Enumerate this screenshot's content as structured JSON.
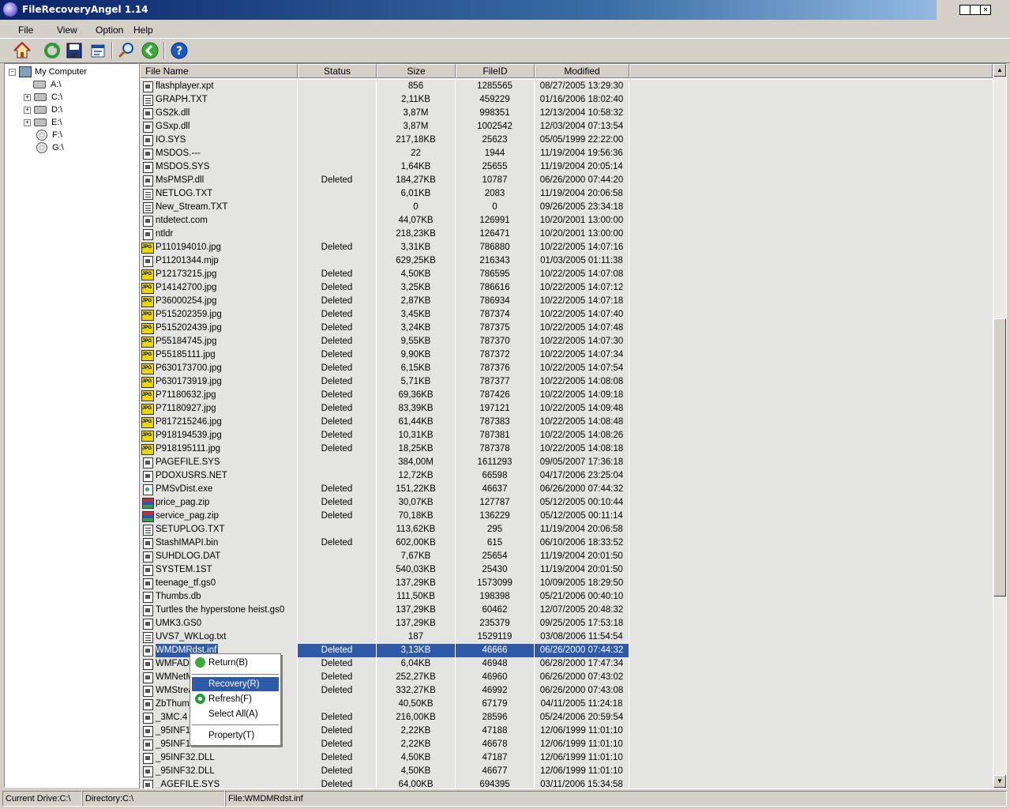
{
  "window": {
    "title": "FileRecoveryAngel 1.14",
    "controls": [
      "minimize",
      "maximize",
      "close"
    ]
  },
  "menu": {
    "file": "File",
    "view": "View",
    "option": "Option",
    "help": "Help"
  },
  "toolbar": {
    "buttons": [
      "home-icon",
      "refresh-icon",
      "save-icon",
      "properties-icon",
      "search-icon",
      "back-icon",
      "help-icon"
    ]
  },
  "tree": {
    "root": "My Computer",
    "drives": [
      "A:\\",
      "C:\\",
      "D:\\",
      "E:\\",
      "F:\\",
      "G:\\"
    ],
    "expanders": [
      "−",
      "+",
      "+",
      "+"
    ]
  },
  "list": {
    "columns": [
      "File Name",
      "Status",
      "Size",
      "FileID",
      "Modified"
    ],
    "rows": [
      {
        "name": "flashplayer.xpt",
        "status": "",
        "size": "856",
        "id": "1285565",
        "modified": "08/27/2005 13:29:30",
        "icon": "sys"
      },
      {
        "name": "GRAPH.TXT",
        "status": "",
        "size": "2,11KB",
        "id": "459229",
        "modified": "01/16/2006 18:02:40",
        "icon": "txt"
      },
      {
        "name": "GS2k.dll",
        "status": "",
        "size": "3,87M",
        "id": "998351",
        "modified": "12/13/2004 10:58:32",
        "icon": "sys"
      },
      {
        "name": "GSxp.dll",
        "status": "",
        "size": "3,87M",
        "id": "1002542",
        "modified": "12/03/2004 07:13:54",
        "icon": "sys"
      },
      {
        "name": "IO.SYS",
        "status": "",
        "size": "217,18KB",
        "id": "25623",
        "modified": "05/05/1999 22:22:00",
        "icon": "sys"
      },
      {
        "name": "MSDOS.---",
        "status": "",
        "size": "22",
        "id": "1944",
        "modified": "11/19/2004 19:56:36",
        "icon": "sys"
      },
      {
        "name": "MSDOS.SYS",
        "status": "",
        "size": "1,64KB",
        "id": "25655",
        "modified": "11/19/2004 20:05:14",
        "icon": "sys"
      },
      {
        "name": "MsPMSP.dll",
        "status": "Deleted",
        "size": "184,27KB",
        "id": "10787",
        "modified": "06/26/2000 07:44:20",
        "icon": "sys"
      },
      {
        "name": "NETLOG.TXT",
        "status": "",
        "size": "6,01KB",
        "id": "2083",
        "modified": "11/19/2004 20:06:58",
        "icon": "txt"
      },
      {
        "name": "New_Stream.TXT",
        "status": "",
        "size": "0",
        "id": "0",
        "modified": "09/26/2005 23:34:18",
        "icon": "txt"
      },
      {
        "name": "ntdetect.com",
        "status": "",
        "size": "44,07KB",
        "id": "126991",
        "modified": "10/20/2001 13:00:00",
        "icon": "sys"
      },
      {
        "name": "ntldr",
        "status": "",
        "size": "218,23KB",
        "id": "126471",
        "modified": "10/20/2001 13:00:00",
        "icon": "sys"
      },
      {
        "name": "P110194010.jpg",
        "status": "Deleted",
        "size": "3,31KB",
        "id": "786880",
        "modified": "10/22/2005 14:07:16",
        "icon": "jpg"
      },
      {
        "name": "P11201344.mjp",
        "status": "",
        "size": "629,25KB",
        "id": "216343",
        "modified": "01/03/2005 01:11:38",
        "icon": "sys"
      },
      {
        "name": "P12173215.jpg",
        "status": "Deleted",
        "size": "4,50KB",
        "id": "786595",
        "modified": "10/22/2005 14:07:08",
        "icon": "jpg"
      },
      {
        "name": "P14142700.jpg",
        "status": "Deleted",
        "size": "3,25KB",
        "id": "786616",
        "modified": "10/22/2005 14:07:12",
        "icon": "jpg"
      },
      {
        "name": "P36000254.jpg",
        "status": "Deleted",
        "size": "2,87KB",
        "id": "786934",
        "modified": "10/22/2005 14:07:18",
        "icon": "jpg"
      },
      {
        "name": "P515202359.jpg",
        "status": "Deleted",
        "size": "3,45KB",
        "id": "787374",
        "modified": "10/22/2005 14:07:40",
        "icon": "jpg"
      },
      {
        "name": "P515202439.jpg",
        "status": "Deleted",
        "size": "3,24KB",
        "id": "787375",
        "modified": "10/22/2005 14:07:48",
        "icon": "jpg"
      },
      {
        "name": "P55184745.jpg",
        "status": "Deleted",
        "size": "9,55KB",
        "id": "787370",
        "modified": "10/22/2005 14:07:30",
        "icon": "jpg"
      },
      {
        "name": "P55185111.jpg",
        "status": "Deleted",
        "size": "9,90KB",
        "id": "787372",
        "modified": "10/22/2005 14:07:34",
        "icon": "jpg"
      },
      {
        "name": "P630173700.jpg",
        "status": "Deleted",
        "size": "6,15KB",
        "id": "787376",
        "modified": "10/22/2005 14:07:54",
        "icon": "jpg"
      },
      {
        "name": "P630173919.jpg",
        "status": "Deleted",
        "size": "5,71KB",
        "id": "787377",
        "modified": "10/22/2005 14:08:08",
        "icon": "jpg"
      },
      {
        "name": "P71180632.jpg",
        "status": "Deleted",
        "size": "69,36KB",
        "id": "787426",
        "modified": "10/22/2005 14:09:18",
        "icon": "jpg"
      },
      {
        "name": "P71180927.jpg",
        "status": "Deleted",
        "size": "83,39KB",
        "id": "197121",
        "modified": "10/22/2005 14:09:48",
        "icon": "jpg"
      },
      {
        "name": "P817215246.jpg",
        "status": "Deleted",
        "size": "61,44KB",
        "id": "787383",
        "modified": "10/22/2005 14:08:48",
        "icon": "jpg"
      },
      {
        "name": "P918194539.jpg",
        "status": "Deleted",
        "size": "10,31KB",
        "id": "787381",
        "modified": "10/22/2005 14:08:26",
        "icon": "jpg"
      },
      {
        "name": "P918195111.jpg",
        "status": "Deleted",
        "size": "18,25KB",
        "id": "787378",
        "modified": "10/22/2005 14:08:18",
        "icon": "jpg"
      },
      {
        "name": "PAGEFILE.SYS",
        "status": "",
        "size": "384,00M",
        "id": "1611293",
        "modified": "09/05/2007 17:36:18",
        "icon": "sys"
      },
      {
        "name": "PDOXUSRS.NET",
        "status": "",
        "size": "12,72KB",
        "id": "66598",
        "modified": "04/17/2006 23:25:04",
        "icon": "sys"
      },
      {
        "name": "PMSvDist.exe",
        "status": "Deleted",
        "size": "151,22KB",
        "id": "46637",
        "modified": "06/26/2000 07:44:32",
        "icon": "exe"
      },
      {
        "name": "price_pag.zip",
        "status": "Deleted",
        "size": "30,07KB",
        "id": "127787",
        "modified": "05/12/2005 00:10:44",
        "icon": "zip"
      },
      {
        "name": "service_pag.zip",
        "status": "Deleted",
        "size": "70,18KB",
        "id": "136229",
        "modified": "05/12/2005 00:11:14",
        "icon": "zip"
      },
      {
        "name": "SETUPLOG.TXT",
        "status": "",
        "size": "113,62KB",
        "id": "295",
        "modified": "11/19/2004 20:06:58",
        "icon": "txt"
      },
      {
        "name": "StashIMAPI.bin",
        "status": "Deleted",
        "size": "602,00KB",
        "id": "615",
        "modified": "06/10/2006 18:33:52",
        "icon": "sys"
      },
      {
        "name": "SUHDLOG.DAT",
        "status": "",
        "size": "7,67KB",
        "id": "25654",
        "modified": "11/19/2004 20:01:50",
        "icon": "sys"
      },
      {
        "name": "SYSTEM.1ST",
        "status": "",
        "size": "540,03KB",
        "id": "25430",
        "modified": "11/19/2004 20:01:50",
        "icon": "sys"
      },
      {
        "name": "teenage_tf.gs0",
        "status": "",
        "size": "137,29KB",
        "id": "1573099",
        "modified": "10/09/2005 18:29:50",
        "icon": "sys"
      },
      {
        "name": "Thumbs.db",
        "status": "",
        "size": "111,50KB",
        "id": "198398",
        "modified": "05/21/2006 00:40:10",
        "icon": "sys"
      },
      {
        "name": "Turtles the hyperstone heist.gs0",
        "status": "",
        "size": "137,29KB",
        "id": "60462",
        "modified": "12/07/2005 20:48:32",
        "icon": "sys"
      },
      {
        "name": "UMK3.GS0",
        "status": "",
        "size": "137,29KB",
        "id": "235379",
        "modified": "09/25/2005 17:53:18",
        "icon": "sys"
      },
      {
        "name": "UVS7_WKLog.txt",
        "status": "",
        "size": "187",
        "id": "1529119",
        "modified": "03/08/2006 11:54:54",
        "icon": "txt"
      },
      {
        "name": "WMDMRdst.inf",
        "status": "Deleted",
        "size": "3,13KB",
        "id": "46666",
        "modified": "06/26/2000 07:44:32",
        "icon": "sys",
        "selected": true
      },
      {
        "name": "WMFADist.exe",
        "status": "Deleted",
        "size": "6,04KB",
        "id": "46948",
        "modified": "06/28/2000 17:47:34",
        "icon": "sys"
      },
      {
        "name": "WMNetMgr.dll",
        "status": "Deleted",
        "size": "252,27KB",
        "id": "46960",
        "modified": "06/26/2000 07:43:02",
        "icon": "sys"
      },
      {
        "name": "WMStream.dll",
        "status": "Deleted",
        "size": "332,27KB",
        "id": "46992",
        "modified": "06/26/2000 07:43:08",
        "icon": "sys"
      },
      {
        "name": "ZbThumbnail.info",
        "status": "",
        "size": "40,50KB",
        "id": "67179",
        "modified": "04/11/2005 11:24:18",
        "icon": "sys"
      },
      {
        "name": "_3MC.4",
        "status": "Deleted",
        "size": "216,00KB",
        "id": "28596",
        "modified": "05/24/2006 20:59:54",
        "icon": "sys"
      },
      {
        "name": "_95INF16.DLL",
        "status": "Deleted",
        "size": "2,22KB",
        "id": "47188",
        "modified": "12/06/1999 11:01:10",
        "icon": "sys"
      },
      {
        "name": "_95INF16.DLL",
        "status": "Deleted",
        "size": "2,22KB",
        "id": "46678",
        "modified": "12/06/1999 11:01:10",
        "icon": "sys"
      },
      {
        "name": "_95INF32.DLL",
        "status": "Deleted",
        "size": "4,50KB",
        "id": "47187",
        "modified": "12/06/1999 11:01:10",
        "icon": "sys"
      },
      {
        "name": "_95INF32.DLL",
        "status": "Deleted",
        "size": "4,50KB",
        "id": "46677",
        "modified": "12/06/1999 11:01:10",
        "icon": "sys"
      },
      {
        "name": "_AGEFILE.SYS",
        "status": "Deleted",
        "size": "64,00KB",
        "id": "694395",
        "modified": "03/11/2006 15:34:58",
        "icon": "sys"
      }
    ]
  },
  "context_menu": {
    "items": [
      {
        "label": "Return(B)",
        "icon": "return-icon"
      },
      {
        "label": "Recovery(R)",
        "highlighted": true
      },
      {
        "label": "Refresh(F)",
        "icon": "refresh-icon"
      },
      {
        "label": "Select All(A)"
      },
      {
        "label": "Property(T)"
      }
    ]
  },
  "statusbar": {
    "drive": "Current Drive:C:\\",
    "directory": "Directory:C:\\",
    "file": "File:WMDMRdst.inf"
  },
  "colors": {
    "title_gradient_start": "#0a246a",
    "selection": "#2f5aa8",
    "face": "#d4d0c8"
  }
}
